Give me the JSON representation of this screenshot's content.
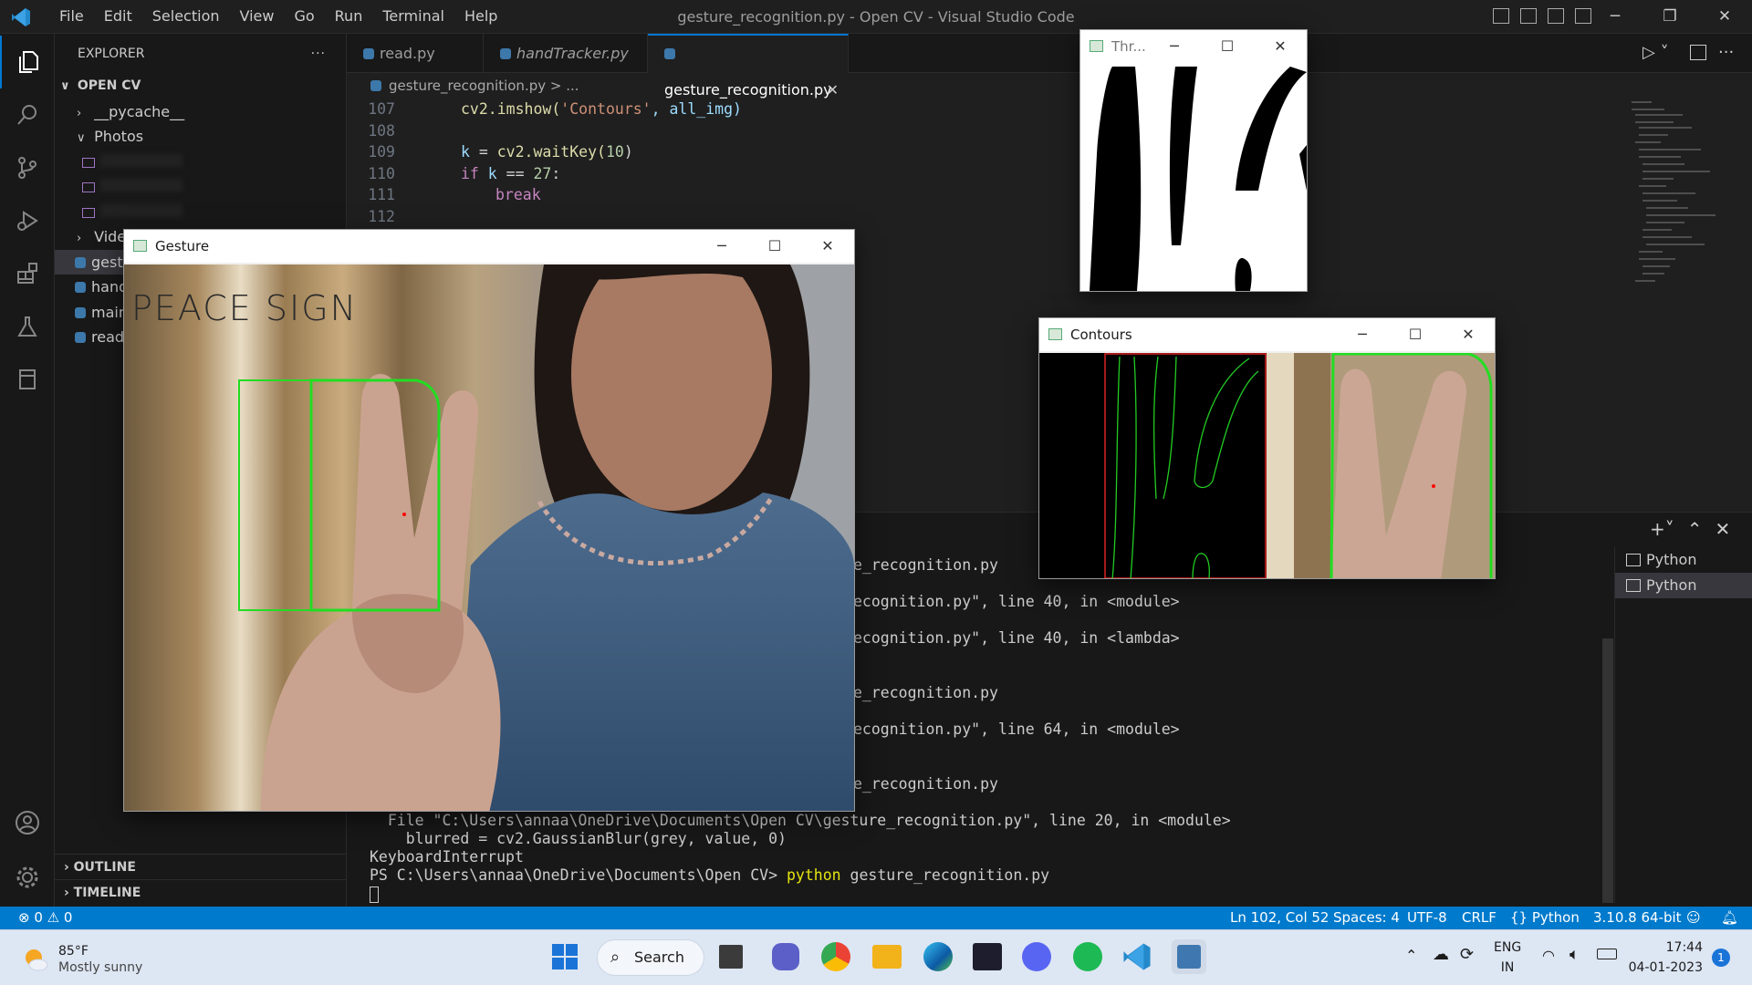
{
  "titlebar": {
    "menu": [
      "File",
      "Edit",
      "Selection",
      "View",
      "Go",
      "Run",
      "Terminal",
      "Help"
    ],
    "title": "gesture_recognition.py - Open CV - Visual Studio Code"
  },
  "sidebar": {
    "header": "EXPLORER",
    "more": "···",
    "folder": "OPEN CV",
    "items": [
      "__pycache__",
      "Photos",
      "Vide",
      "gest",
      "hand",
      "main",
      "read"
    ],
    "outline": "OUTLINE",
    "timeline": "TIMELINE"
  },
  "tabs": [
    "read.py",
    "handTracker.py",
    "gesture_recognition.py"
  ],
  "breadcrumb": "gesture_recognition.py > ...",
  "code": {
    "line_numbers": [
      "107",
      "108",
      "109",
      "110",
      "111",
      "112"
    ],
    "l107_fn": "cv2.imshow(",
    "l107_str": "'Contours'",
    "l107_rest": ", all_img)",
    "l109_var": "k",
    "l109_eq": " = ",
    "l109_fn": "cv2.waitKey(",
    "l109_num": "10",
    "l109_close": ")",
    "l110_kw": "if",
    "l110_var": " k",
    "l110_op": " == ",
    "l110_num": "27",
    "l110_colon": ":",
    "l111_kw": "break"
  },
  "terminal": {
    "lines": [
      "e_recognition.py",
      "ecognition.py\", line 40, in <module>",
      "ecognition.py\", line 40, in <lambda>",
      "e_recognition.py",
      "ecognition.py\", line 64, in <module>",
      "e_recognition.py",
      "  File \"C:\\Users\\annaa\\OneDrive\\Documents\\Open CV\\gesture_recognition.py\", line 20, in <module>",
      "    blurred = cv2.GaussianBlur(grey, value, 0)",
      "KeyboardInterrupt"
    ],
    "prompt": "PS C:\\Users\\annaa\\OneDrive\\Documents\\Open CV> ",
    "cmd": "python",
    "arg": " gesture_recognition.py",
    "sessions": [
      "Python",
      "Python"
    ]
  },
  "status": {
    "errors": "⊗ 0 ⚠ 0",
    "position": "Ln 102, Col 52",
    "spaces": "Spaces: 4",
    "encoding": "UTF-8",
    "eol": "CRLF",
    "language": "{} Python",
    "interpreter": "3.10.8 64-bit"
  },
  "windows": {
    "gesture": {
      "title": "Gesture",
      "overlay_text": "PEACE SIGN"
    },
    "threshold": {
      "title": "Thr..."
    },
    "contours": {
      "title": "Contours"
    }
  },
  "taskbar": {
    "temp": "85°F",
    "weather": "Mostly sunny",
    "search": "Search",
    "lang1": "ENG",
    "lang2": "IN",
    "time": "17:44",
    "date": "04-01-2023",
    "badge": "1"
  },
  "colors": {
    "accent": "#0078d4",
    "statusbar": "#007acc",
    "contour_green": "#22dd22"
  }
}
